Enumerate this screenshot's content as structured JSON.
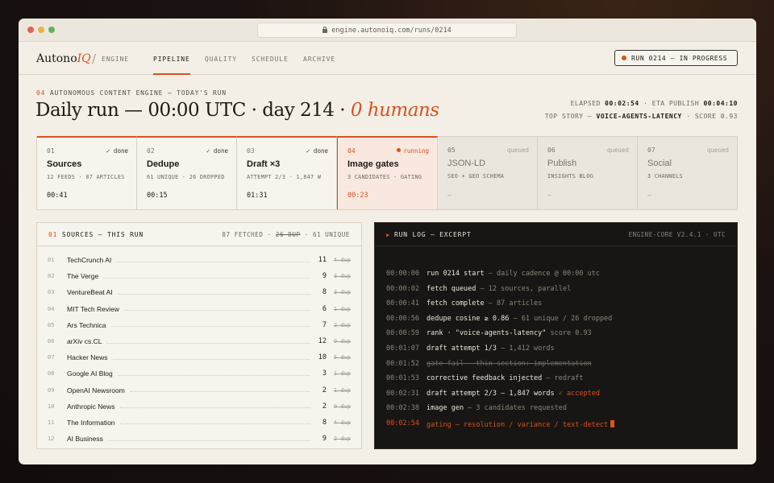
{
  "browser": {
    "url": "engine.autonoiq.com/runs/0214"
  },
  "brand": {
    "name_main": "Autono",
    "name_accent": "IQ",
    "sub": "ENGINE"
  },
  "nav": {
    "tabs": [
      {
        "label": "PIPELINE",
        "active": true
      },
      {
        "label": "QUALITY",
        "active": false
      },
      {
        "label": "SCHEDULE",
        "active": false
      },
      {
        "label": "ARCHIVE",
        "active": false
      }
    ],
    "status": "RUN 0214 — IN PROGRESS"
  },
  "header": {
    "kicker_num": "04",
    "kicker_text": "AUTONOMOUS CONTENT ENGINE — TODAY'S RUN",
    "title_main": "Daily run — 00:00 UTC · day 214 ·",
    "title_accent": "0 humans",
    "elapsed_label": "ELAPSED",
    "elapsed_value": "00:02:54",
    "eta_label": "· ETA PUBLISH",
    "eta_value": "00:04:10",
    "top_story_label": "TOP STORY —",
    "top_story_value": "VOICE-AGENTS-LATENCY",
    "score_label": "· SCORE 0.93"
  },
  "stages": [
    {
      "num": "01",
      "state": "✓ done",
      "status": "done",
      "title": "Sources",
      "desc": "12 FEEDS · 87 ARTICLES",
      "time": "00:41"
    },
    {
      "num": "02",
      "state": "✓ done",
      "status": "done",
      "title": "Dedupe",
      "desc": "61 UNIQUE · 26 DROPPED",
      "time": "00:15"
    },
    {
      "num": "03",
      "state": "✓ done",
      "status": "done",
      "title": "Draft ×3",
      "desc": "ATTEMPT 2/3 · 1,847 W",
      "time": "01:31"
    },
    {
      "num": "04",
      "state": "running",
      "status": "running",
      "title": "Image gates",
      "desc": "3 CANDIDATES · GATING",
      "time": "00:23"
    },
    {
      "num": "05",
      "state": "queued",
      "status": "queued",
      "title": "JSON-LD",
      "desc": "SEO + GEO SCHEMA",
      "time": "—"
    },
    {
      "num": "06",
      "state": "queued",
      "status": "queued",
      "title": "Publish",
      "desc": "INSIGHTS BLOG",
      "time": "—"
    },
    {
      "num": "07",
      "state": "queued",
      "status": "queued",
      "title": "Social",
      "desc": "3 CHANNELS",
      "time": "—"
    }
  ],
  "sources": {
    "title_num": "01",
    "title": "SOURCES — THIS RUN",
    "summary_fetched": "87 FETCHED ·",
    "summary_dup": "26 DUP",
    "summary_unique": "· 61 UNIQUE",
    "items": [
      {
        "idx": "01",
        "name": "TechCrunch AI",
        "count": "11",
        "dup": "4 dup"
      },
      {
        "idx": "02",
        "name": "The Verge",
        "count": "9",
        "dup": "3 dup"
      },
      {
        "idx": "03",
        "name": "VentureBeat AI",
        "count": "8",
        "dup": "3 dup"
      },
      {
        "idx": "04",
        "name": "MIT Tech Review",
        "count": "6",
        "dup": "1 dup"
      },
      {
        "idx": "05",
        "name": "Ars Technica",
        "count": "7",
        "dup": "2 dup"
      },
      {
        "idx": "06",
        "name": "arXiv cs.CL",
        "count": "12",
        "dup": "0 dup"
      },
      {
        "idx": "07",
        "name": "Hacker News",
        "count": "10",
        "dup": "5 dup"
      },
      {
        "idx": "08",
        "name": "Google AI Blog",
        "count": "3",
        "dup": "1 dup"
      },
      {
        "idx": "09",
        "name": "OpenAI Newsroom",
        "count": "2",
        "dup": "1 dup"
      },
      {
        "idx": "10",
        "name": "Anthropic News",
        "count": "2",
        "dup": "0 dup"
      },
      {
        "idx": "11",
        "name": "The Information",
        "count": "8",
        "dup": "4 dup"
      },
      {
        "idx": "12",
        "name": "AI Business",
        "count": "9",
        "dup": "2 dup"
      }
    ]
  },
  "log": {
    "title": "RUN LOG — EXCERPT",
    "engine": "ENGINE-CORE V2.4.1 · UTC",
    "lines": [
      {
        "ts": "00:00:00",
        "cmd": "run 0214 start",
        "note": " — daily cadence @ 00:00 utc",
        "style": ""
      },
      {
        "ts": "00:00:02",
        "cmd": "fetch queued",
        "note": " — 12 sources, parallel",
        "style": ""
      },
      {
        "ts": "00:00:41",
        "cmd": "fetch complete",
        "note": " — 87 articles",
        "style": ""
      },
      {
        "ts": "00:00:56",
        "cmd": "dedupe cosine ≥ 0.86",
        "note": " — 61 unique / 26 dropped",
        "style": ""
      },
      {
        "ts": "00:00:59",
        "cmd": "rank · \"voice-agents-latency\"",
        "note": " score 0.93",
        "style": ""
      },
      {
        "ts": "00:01:07",
        "cmd": "draft attempt 1/3",
        "note": " — 1,412 words",
        "style": ""
      },
      {
        "ts": "00:01:52",
        "cmd": "gate fail",
        "note": " — thin section: implementation",
        "style": "strike"
      },
      {
        "ts": "00:01:53",
        "cmd": "corrective feedback injected",
        "note": " — redraft",
        "style": ""
      },
      {
        "ts": "00:02:31",
        "cmd": "draft attempt 2/3 — 1,847 words",
        "note": "",
        "accent": " ✓ accepted",
        "style": ""
      },
      {
        "ts": "00:02:38",
        "cmd": "image gen",
        "note": " — 3 candidates requested",
        "style": ""
      },
      {
        "ts": "00:02:54",
        "cmd": "gating — resolution / variance / text-detect",
        "note": "",
        "style": "current"
      }
    ]
  },
  "colors": {
    "accent": "#d9521f",
    "bg": "#f3efe6",
    "log_bg": "#181614"
  }
}
